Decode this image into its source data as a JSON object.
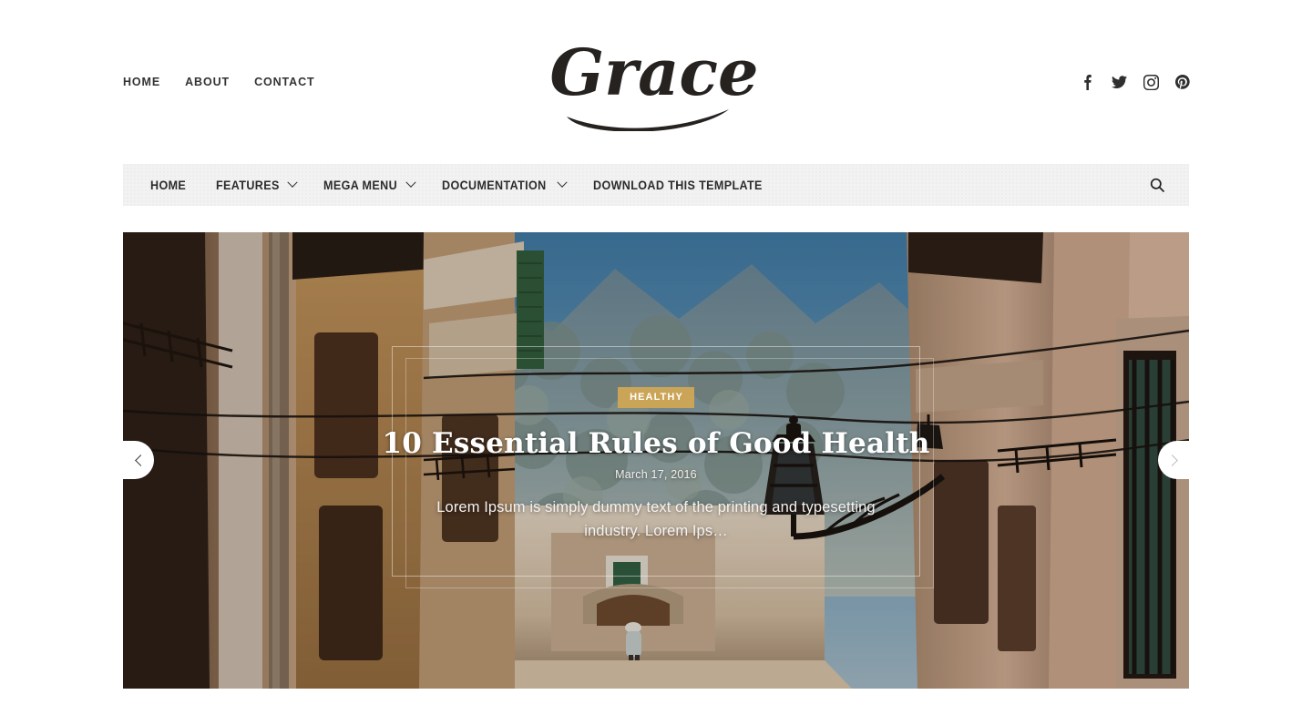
{
  "site": {
    "logo_text": "Grace"
  },
  "topbar": {
    "links": [
      {
        "label": "HOME"
      },
      {
        "label": "ABOUT"
      },
      {
        "label": "CONTACT"
      }
    ],
    "social": [
      {
        "name": "facebook",
        "label": "Facebook"
      },
      {
        "name": "twitter",
        "label": "Twitter"
      },
      {
        "name": "instagram",
        "label": "Instagram"
      },
      {
        "name": "pinterest",
        "label": "Pinterest"
      }
    ]
  },
  "mainnav": {
    "items": [
      {
        "label": "HOME",
        "has_dropdown": false
      },
      {
        "label": "FEATURES",
        "has_dropdown": true
      },
      {
        "label": "MEGA MENU",
        "has_dropdown": true
      },
      {
        "label": "DOCUMENTATION",
        "has_dropdown": true
      },
      {
        "label": "DOWNLOAD THIS TEMPLATE",
        "has_dropdown": false
      }
    ],
    "search_icon": "search-icon",
    "background_color": "#f2f2f2"
  },
  "hero": {
    "category": "HEALTHY",
    "category_color": "#cba557",
    "title": "10 Essential Rules of Good Health",
    "date": "March 17, 2016",
    "excerpt": "Lorem Ipsum is simply dummy text of the printing and typesetting industry. Lorem Ips…",
    "prev_label": "Previous slide",
    "next_label": "Next slide"
  }
}
